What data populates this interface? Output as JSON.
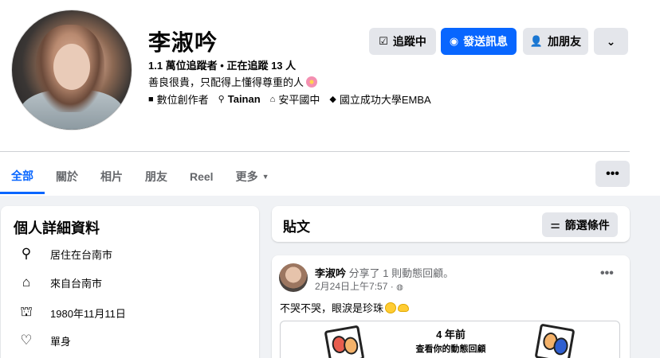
{
  "profile": {
    "name": "李淑吟",
    "followers_text": "1.1 萬位追蹤者 • 正在追蹤 13 人",
    "bio": "善良很貴，只配得上懂得尊重的人",
    "bio_icon": "flower-emoji",
    "meta": [
      {
        "icon": "briefcase-icon",
        "text": "數位創作者"
      },
      {
        "icon": "location-pin-icon",
        "text": "Tainan"
      },
      {
        "icon": "school-icon",
        "text": "安平國中"
      },
      {
        "icon": "graduation-cap-icon",
        "text": "國立成功大學EMBA"
      }
    ]
  },
  "actions": {
    "following_label": "追蹤中",
    "message_label": "發送訊息",
    "add_friend_label": "加朋友",
    "more_label": "⌄"
  },
  "tabs": [
    {
      "label": "全部",
      "active": true
    },
    {
      "label": "關於"
    },
    {
      "label": "相片"
    },
    {
      "label": "朋友"
    },
    {
      "label": "Reel"
    },
    {
      "label": "更多"
    }
  ],
  "tabs_more_button": "•••",
  "intro": {
    "title": "個人詳細資料",
    "rows": [
      {
        "icon": "location-pin-icon",
        "text": "居住在台南市"
      },
      {
        "icon": "home-icon",
        "text": "來自台南市"
      },
      {
        "icon": "birthday-cake-icon",
        "text": "1980年11月11日"
      },
      {
        "icon": "heart-icon",
        "text": "單身"
      }
    ]
  },
  "posts": {
    "title": "貼文",
    "filter_label": "篩選條件"
  },
  "post": {
    "author": "李淑吟",
    "action": "分享了 1 則動態回顧。",
    "time": "2月24日上午7:57 ·",
    "more": "•••",
    "text": "不哭不哭，眼淚是珍珠",
    "memory": {
      "years": "4 年前",
      "subtitle": "查看你的動態回顧"
    }
  },
  "colors": {
    "accent": "#0866ff",
    "button_gray": "#e4e6eb",
    "background": "#f0f2f5",
    "secondary_text": "#65676b"
  }
}
